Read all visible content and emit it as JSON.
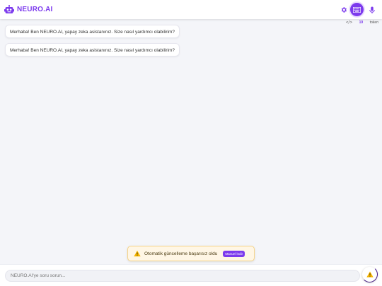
{
  "app": {
    "name": "NEURO.AI",
    "brand_color": "#7c3aed",
    "logo_icon": "robot-icon"
  },
  "header": {
    "settings_icon": "gear-icon",
    "keyboard_icon": "keyboard-icon",
    "mic_icon": "microphone-icon"
  },
  "token_counter": {
    "code_symbol": "</>",
    "count": "19",
    "label": "token"
  },
  "messages": [
    {
      "role": "assistant",
      "text": "Merhaba! Ben NEURO.AI, yapay zeka asistanınız. Size nasıl yardımcı olabilirim?"
    },
    {
      "role": "assistant",
      "text": "Merhaba! Ben NEURO.AI, yapay zeka asistanınız. Size nasıl yardımcı olabilirim?"
    }
  ],
  "toast": {
    "icon": "warning-icon",
    "text": "Otomatik güncelleme başarısız oldu",
    "button_label": "Manuel İndir"
  },
  "input": {
    "placeholder": "NEURO.AI'ye soru sorun...",
    "value": ""
  },
  "fab": {
    "icon": "warning-icon"
  }
}
